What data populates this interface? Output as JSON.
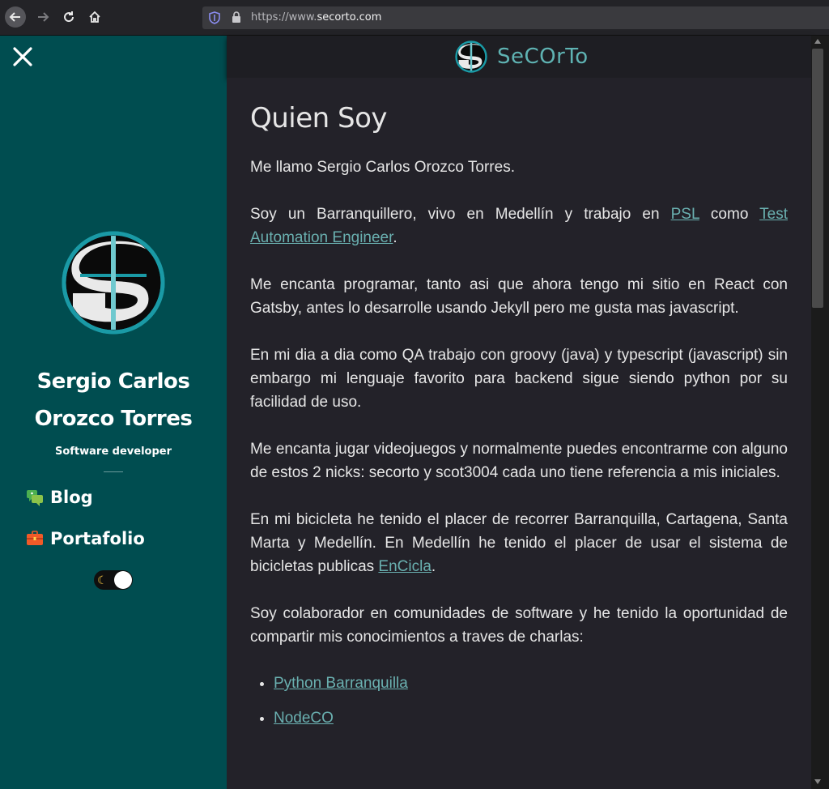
{
  "browser": {
    "url_prefix": "https://www.",
    "url_domain": "secorto.com"
  },
  "sidebar": {
    "author_line1": "Sergio Carlos",
    "author_line2": "Orozco Torres",
    "role": "Software developer",
    "menu": [
      {
        "label": "Blog",
        "icon": "chat-icon"
      },
      {
        "label": "Portafolio",
        "icon": "briefcase-icon"
      }
    ],
    "theme_toggle": {
      "state": "light",
      "icon": "moon-icon"
    }
  },
  "header": {
    "brand": "SeCOrTo"
  },
  "content": {
    "title": "Quien Soy",
    "p1": "Me llamo Sergio Carlos Orozco Torres.",
    "p2_before": "Soy un Barranquillero, vivo en Medellín y trabajo en ",
    "p2_link1": "PSL",
    "p2_mid": " como ",
    "p2_link2": "Test Automation Engineer",
    "p2_after": ".",
    "p3": "Me encanta programar, tanto asi que ahora tengo mi sitio en React con Gatsby, antes lo desarrolle usando Jekyll pero me gusta mas javascript.",
    "p4": "En mi dia a dia como QA trabajo con groovy (java) y typescript (javascript) sin embargo mi lenguaje favorito para backend sigue siendo python por su facilidad de uso.",
    "p5": "Me encanta jugar videojuegos y normalmente puedes encontrarme con alguno de estos 2 nicks: secorto y scot3004 cada uno tiene referencia a mis iniciales.",
    "p6_before": "En mi bicicleta he tenido el placer de recorrer Barranquilla, Cartagena, Santa Marta y Medellín. En Medellín he tenido el placer de usar el sistema de bicicletas publicas ",
    "p6_link": "EnCicla",
    "p6_after": ".",
    "p7": "Soy colaborador en comunidades de software y he tenido la oportunidad de compartir mis conocimientos a traves de charlas:",
    "communities": [
      "Python Barranquilla",
      "NodeCO"
    ]
  }
}
